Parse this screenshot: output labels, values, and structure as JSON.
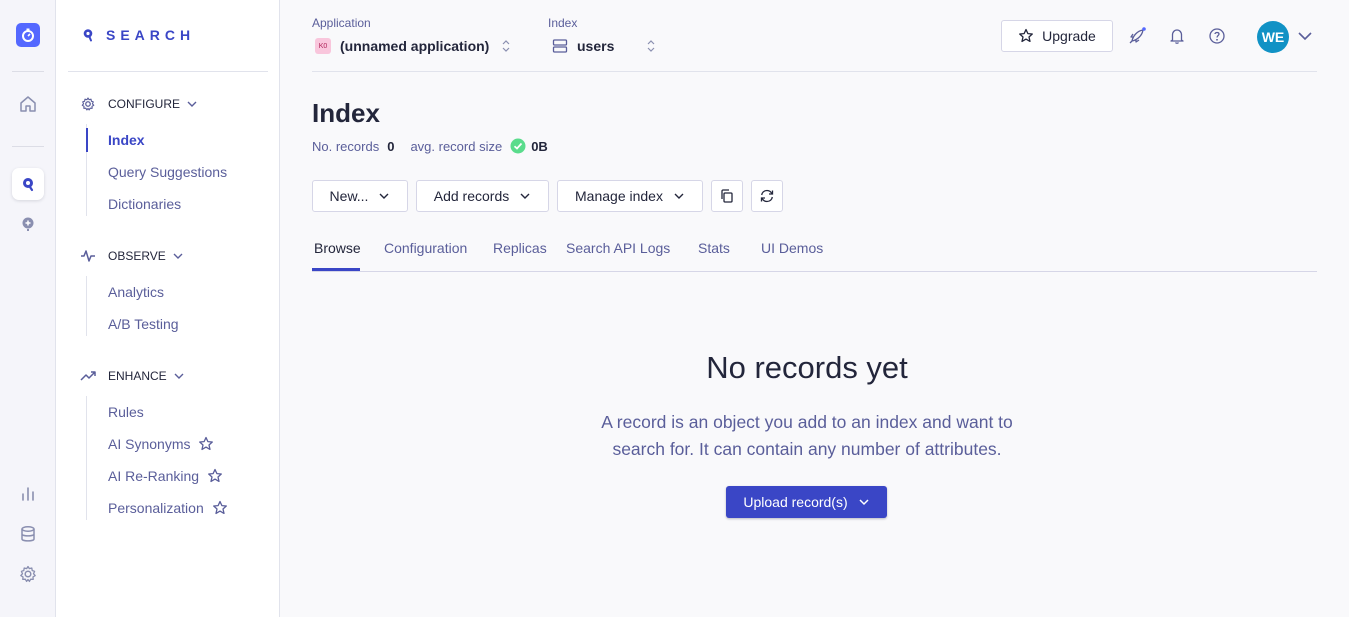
{
  "app": {
    "brand": "SEARCH"
  },
  "rail": {
    "icons": [
      "app-logo-icon",
      "home-icon",
      "search-product-icon",
      "recommend-icon",
      "analytics-icon",
      "data-sources-icon",
      "settings-icon"
    ]
  },
  "sidebar": {
    "sections": [
      {
        "title": "CONFIGURE",
        "icon": "gear-icon",
        "items": [
          "Index",
          "Query Suggestions",
          "Dictionaries"
        ]
      },
      {
        "title": "OBSERVE",
        "icon": "pulse-icon",
        "items": [
          "Analytics",
          "A/B Testing"
        ]
      },
      {
        "title": "ENHANCE",
        "icon": "trend-icon",
        "items": [
          "Rules",
          "AI Synonyms",
          "AI Re-Ranking",
          "Personalization"
        ]
      }
    ],
    "active_item": "Index"
  },
  "header": {
    "application_label": "Application",
    "application_badge": "K0",
    "application_value": "(unnamed application)",
    "index_label": "Index",
    "index_value": "users",
    "upgrade_label": "Upgrade",
    "avatar_initials": "WE"
  },
  "page": {
    "title": "Index",
    "records_label": "No. records",
    "records_value": "0",
    "record_size_label": "avg. record size",
    "record_size_value": "0B"
  },
  "toolbar": {
    "new_label": "New...",
    "add_records_label": "Add records",
    "manage_index_label": "Manage index"
  },
  "tabs": [
    "Browse",
    "Configuration",
    "Replicas",
    "Search API Logs",
    "Stats",
    "UI Demos"
  ],
  "active_tab": "Browse",
  "empty_state": {
    "title": "No records yet",
    "description": "A record is an object you add to an index and want to search for. It can contain any number of attributes.",
    "upload_label": "Upload record(s)"
  },
  "colors": {
    "accent": "#3a46c6",
    "brand": "#5468ff",
    "avatar": "#1192c5",
    "success": "#5adc8c"
  }
}
